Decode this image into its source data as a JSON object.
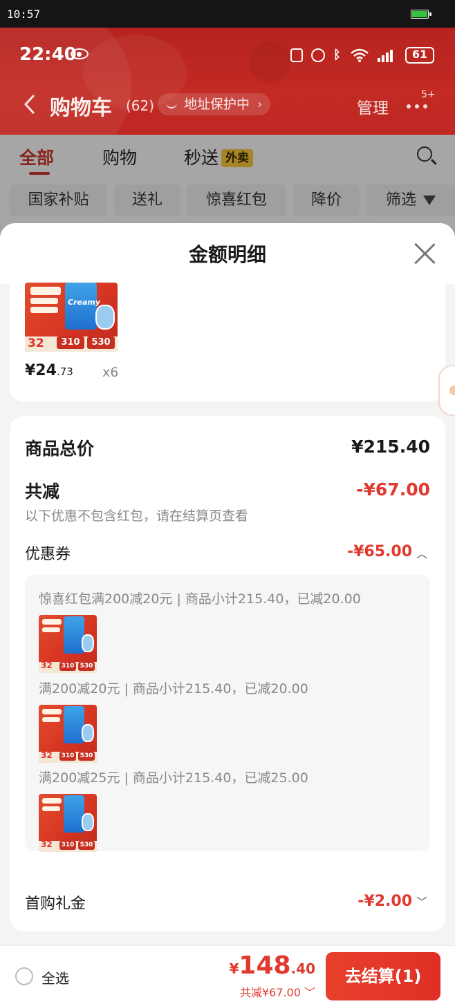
{
  "outer_status": {
    "time": "10:57"
  },
  "phone_status": {
    "time": "22:40",
    "battery": "61"
  },
  "nav": {
    "title": "购物车",
    "count": "(62)",
    "address_badge": "地址保护中",
    "manage": "管理",
    "more_badge": "5+"
  },
  "tabs": [
    {
      "label": "全部",
      "active": true
    },
    {
      "label": "购物"
    },
    {
      "label": "秒送",
      "badge": "外卖"
    }
  ],
  "chips": [
    "国家补贴",
    "送礼",
    "惊喜红包",
    "降价",
    "筛选"
  ],
  "sheet": {
    "title": "金额明细",
    "item": {
      "price_main": "¥24",
      "price_decimal": ".73",
      "qty": "x6",
      "image": {
        "badge_price": "32",
        "price_a": "310",
        "price_b": "530",
        "brand_text": "Creamy"
      }
    },
    "summary": {
      "total_label": "商品总价",
      "total_value": "¥215.40",
      "discount_label": "共减",
      "discount_value": "-¥67.00",
      "note": "以下优惠不包含红包，请在结算页查看",
      "coupon_label": "优惠券",
      "coupon_value": "-¥65.00",
      "coupons": [
        {
          "text": "惊喜红包满200减20元 | 商品小计215.40，已减20.00"
        },
        {
          "text": "满200减20元 | 商品小计215.40，已减20.00"
        },
        {
          "text": "满200减25元 | 商品小计215.40，已减25.00"
        }
      ],
      "gift_label": "首购礼金",
      "gift_value": "-¥2.00"
    }
  },
  "bottom": {
    "select_all": "全选",
    "currency": "¥",
    "total_main": "148",
    "total_decimal": ".40",
    "saved": "共减¥67.00",
    "checkout": "去结算(1)"
  },
  "colors": {
    "brand_red": "#e0392d",
    "header_red": "#bf2823",
    "takeout_yellow": "#f5c33b"
  }
}
